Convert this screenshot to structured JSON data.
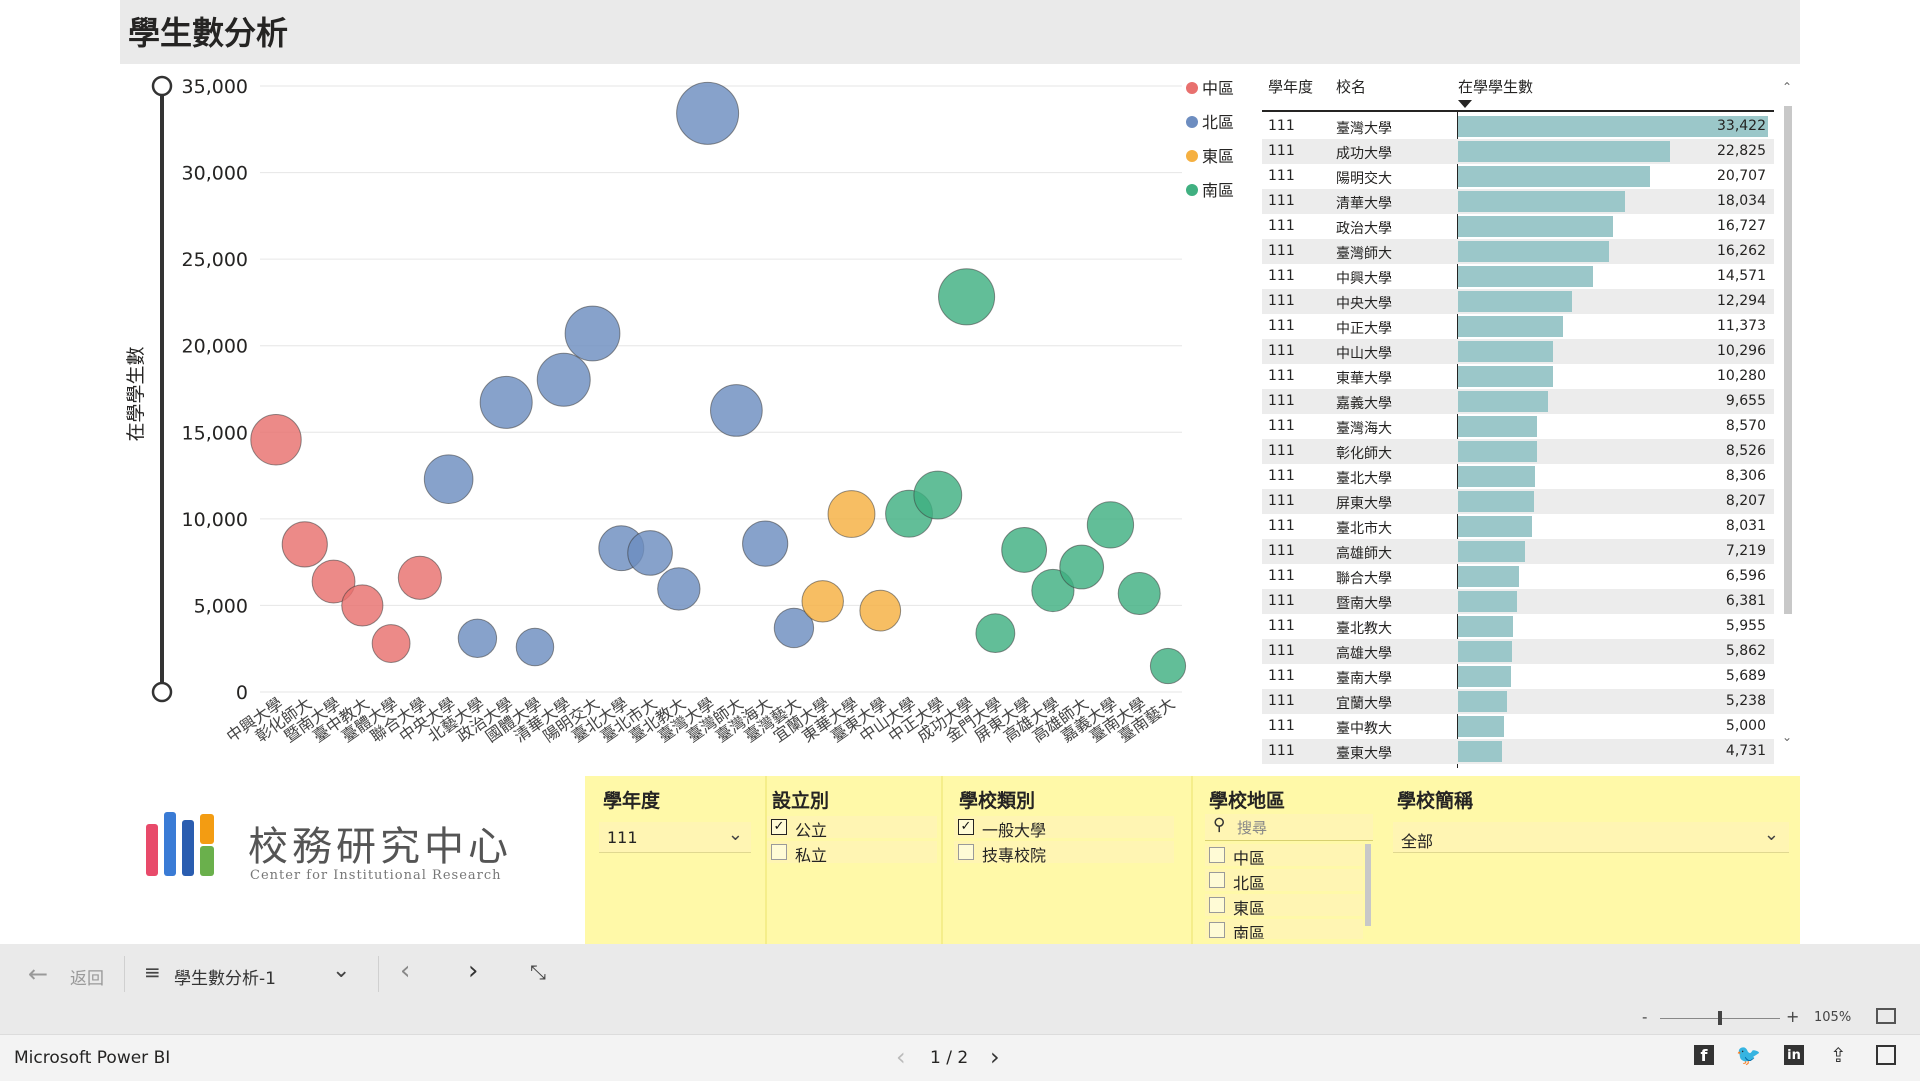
{
  "page": {
    "title": "學生數分析"
  },
  "chart_data": {
    "type": "scatter",
    "ylabel": "在學學生數",
    "ylim": [
      0,
      35000
    ],
    "yticks": [
      "0",
      "5,000",
      "10,000",
      "15,000",
      "20,000",
      "25,000",
      "30,000",
      "35,000"
    ],
    "legend": {
      "position": "top-right",
      "items": [
        {
          "name": "中區",
          "color": "#e8706e"
        },
        {
          "name": "北區",
          "color": "#6d8dc0"
        },
        {
          "name": "東區",
          "color": "#f5b041"
        },
        {
          "name": "南區",
          "color": "#40b081"
        }
      ]
    },
    "categories": [
      "中興大學",
      "彰化師大",
      "暨南大學",
      "臺中教大",
      "臺體大學",
      "聯合大學",
      "中央大學",
      "北藝大學",
      "政治大學",
      "國體大學",
      "清華大學",
      "陽明交大",
      "臺北大學",
      "臺北市大",
      "臺北教大",
      "臺灣大學",
      "臺灣師大",
      "臺灣海大",
      "臺灣藝大",
      "宜蘭大學",
      "東華大學",
      "臺東大學",
      "中山大學",
      "中正大學",
      "成功大學",
      "金門大學",
      "屏東大學",
      "高雄大學",
      "高雄師大",
      "嘉義大學",
      "臺南大學",
      "臺南藝大"
    ],
    "series": [
      {
        "name": "中區",
        "color": "#e8706e",
        "points": [
          {
            "x": "中興大學",
            "y": 14571
          },
          {
            "x": "彰化師大",
            "y": 8526
          },
          {
            "x": "暨南大學",
            "y": 6381
          },
          {
            "x": "臺中教大",
            "y": 5000
          },
          {
            "x": "臺體大學",
            "y": 2800
          },
          {
            "x": "聯合大學",
            "y": 6596
          }
        ]
      },
      {
        "name": "北區",
        "color": "#6d8dc0",
        "points": [
          {
            "x": "中央大學",
            "y": 12294
          },
          {
            "x": "北藝大學",
            "y": 3100
          },
          {
            "x": "政治大學",
            "y": 16727
          },
          {
            "x": "國體大學",
            "y": 2600
          },
          {
            "x": "清華大學",
            "y": 18034
          },
          {
            "x": "陽明交大",
            "y": 20707
          },
          {
            "x": "臺北大學",
            "y": 8306
          },
          {
            "x": "臺北市大",
            "y": 8031
          },
          {
            "x": "臺北教大",
            "y": 5955
          },
          {
            "x": "臺灣大學",
            "y": 33422
          },
          {
            "x": "臺灣師大",
            "y": 16262
          },
          {
            "x": "臺灣海大",
            "y": 8570
          },
          {
            "x": "臺灣藝大",
            "y": 3700
          }
        ]
      },
      {
        "name": "東區",
        "color": "#f5b041",
        "points": [
          {
            "x": "宜蘭大學",
            "y": 5238
          },
          {
            "x": "東華大學",
            "y": 10280
          },
          {
            "x": "臺東大學",
            "y": 4700
          }
        ]
      },
      {
        "name": "南區",
        "color": "#40b081",
        "points": [
          {
            "x": "中山大學",
            "y": 10296
          },
          {
            "x": "中正大學",
            "y": 11373
          },
          {
            "x": "成功大學",
            "y": 22825
          },
          {
            "x": "金門大學",
            "y": 3400
          },
          {
            "x": "屏東大學",
            "y": 8207
          },
          {
            "x": "高雄大學",
            "y": 5862
          },
          {
            "x": "高雄師大",
            "y": 7219
          },
          {
            "x": "嘉義大學",
            "y": 9655
          },
          {
            "x": "臺南大學",
            "y": 5689
          },
          {
            "x": "臺南藝大",
            "y": 1500
          }
        ]
      }
    ]
  },
  "table": {
    "headers": {
      "year": "學年度",
      "school": "校名",
      "students": "在學學生數"
    },
    "max": 33422,
    "rows": [
      {
        "year": "111",
        "school": "臺灣大學",
        "value": 33422,
        "label": "33,422"
      },
      {
        "year": "111",
        "school": "成功大學",
        "value": 22825,
        "label": "22,825"
      },
      {
        "year": "111",
        "school": "陽明交大",
        "value": 20707,
        "label": "20,707"
      },
      {
        "year": "111",
        "school": "清華大學",
        "value": 18034,
        "label": "18,034"
      },
      {
        "year": "111",
        "school": "政治大學",
        "value": 16727,
        "label": "16,727"
      },
      {
        "year": "111",
        "school": "臺灣師大",
        "value": 16262,
        "label": "16,262"
      },
      {
        "year": "111",
        "school": "中興大學",
        "value": 14571,
        "label": "14,571"
      },
      {
        "year": "111",
        "school": "中央大學",
        "value": 12294,
        "label": "12,294"
      },
      {
        "year": "111",
        "school": "中正大學",
        "value": 11373,
        "label": "11,373"
      },
      {
        "year": "111",
        "school": "中山大學",
        "value": 10296,
        "label": "10,296"
      },
      {
        "year": "111",
        "school": "東華大學",
        "value": 10280,
        "label": "10,280"
      },
      {
        "year": "111",
        "school": "嘉義大學",
        "value": 9655,
        "label": "9,655"
      },
      {
        "year": "111",
        "school": "臺灣海大",
        "value": 8570,
        "label": "8,570"
      },
      {
        "year": "111",
        "school": "彰化師大",
        "value": 8526,
        "label": "8,526"
      },
      {
        "year": "111",
        "school": "臺北大學",
        "value": 8306,
        "label": "8,306"
      },
      {
        "year": "111",
        "school": "屏東大學",
        "value": 8207,
        "label": "8,207"
      },
      {
        "year": "111",
        "school": "臺北市大",
        "value": 8031,
        "label": "8,031"
      },
      {
        "year": "111",
        "school": "高雄師大",
        "value": 7219,
        "label": "7,219"
      },
      {
        "year": "111",
        "school": "聯合大學",
        "value": 6596,
        "label": "6,596"
      },
      {
        "year": "111",
        "school": "暨南大學",
        "value": 6381,
        "label": "6,381"
      },
      {
        "year": "111",
        "school": "臺北教大",
        "value": 5955,
        "label": "5,955"
      },
      {
        "year": "111",
        "school": "高雄大學",
        "value": 5862,
        "label": "5,862"
      },
      {
        "year": "111",
        "school": "臺南大學",
        "value": 5689,
        "label": "5,689"
      },
      {
        "year": "111",
        "school": "宜蘭大學",
        "value": 5238,
        "label": "5,238"
      },
      {
        "year": "111",
        "school": "臺中教大",
        "value": 5000,
        "label": "5,000"
      },
      {
        "year": "111",
        "school": "臺東大學",
        "value": 4731,
        "label": "4,731"
      }
    ]
  },
  "slicers": {
    "year": {
      "title": "學年度",
      "value": "111"
    },
    "type": {
      "title": "設立別",
      "options": [
        {
          "label": "公立",
          "checked": true
        },
        {
          "label": "私立",
          "checked": false
        }
      ]
    },
    "category": {
      "title": "學校類別",
      "options": [
        {
          "label": "一般大學",
          "checked": true
        },
        {
          "label": "技專校院",
          "checked": false
        }
      ]
    },
    "region": {
      "title": "學校地區",
      "search_placeholder": "搜尋",
      "options": [
        {
          "label": "中區"
        },
        {
          "label": "北區"
        },
        {
          "label": "東區"
        },
        {
          "label": "南區"
        }
      ]
    },
    "school": {
      "title": "學校簡稱",
      "value": "全部"
    }
  },
  "logo": {
    "text": "校務研究中心",
    "subtext": "Center for Institutional Research"
  },
  "nav": {
    "back": "返回",
    "page_name": "學生數分析-1"
  },
  "zoom": {
    "level": "105%"
  },
  "footer": {
    "app": "Microsoft Power BI",
    "pager": "1 / 2"
  },
  "icons": {
    "back": "arrow-left-icon",
    "pages": "list-icon",
    "prev": "chevron-left-icon",
    "next": "chevron-right-icon",
    "collapse": "collapse-icon",
    "facebook": "facebook-icon",
    "twitter": "twitter-icon",
    "linkedin": "linkedin-icon",
    "share": "share-icon",
    "fullscreen": "fullscreen-icon"
  }
}
